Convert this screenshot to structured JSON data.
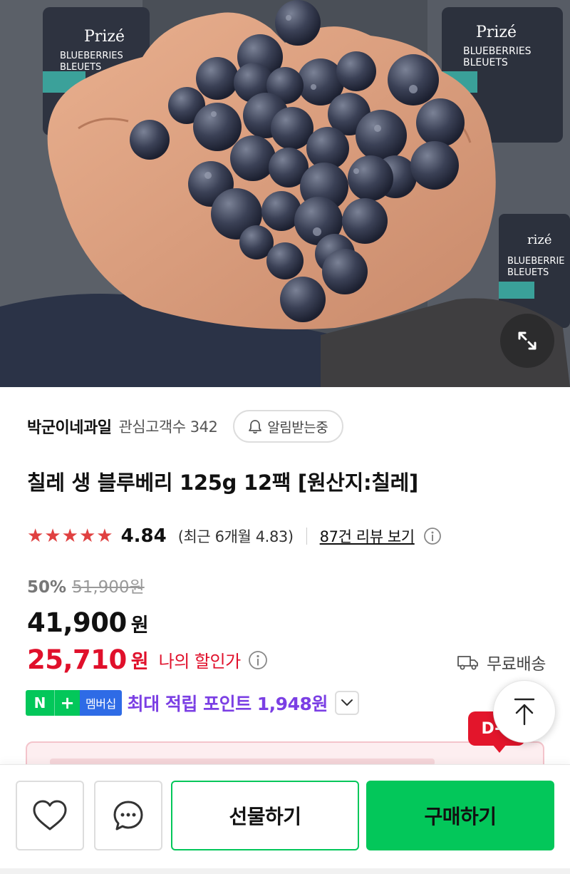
{
  "product_image": {
    "alt": "blueberries-in-hands",
    "package_brand": "Prizé",
    "package_label_1": "BLUEBERRIES",
    "package_label_2": "BLEUETS",
    "expand_icon": "expand-icon"
  },
  "store": {
    "name": "박군이네과일",
    "fans_label": "관심고객수 342",
    "alarm_label": "알림받는중",
    "alarm_icon": "bell-icon"
  },
  "product": {
    "title": "칠레 생 블루베리 125g 12팩 [원산지:칠레]"
  },
  "rating": {
    "stars": 5,
    "score": "4.84",
    "recent": "(최근 6개월 4.83)",
    "reviews_link": "87건 리뷰 보기"
  },
  "price": {
    "discount_rate": "50%",
    "original": "51,900원",
    "sale": "41,900",
    "won": "원",
    "my_price": "25,710",
    "my_won": "원",
    "my_label": "나의 할인가",
    "shipping": "무료배송"
  },
  "membership": {
    "n_label": "N",
    "plus_label": "+",
    "member_label": "멤버십",
    "points_text": "최대 적립 포인트 1,948원"
  },
  "badge": {
    "dday": "D-7"
  },
  "bottom_bar": {
    "gift_label": "선물하기",
    "buy_label": "구매하기"
  },
  "colors": {
    "naver_green": "#03c75a",
    "discount_red": "#e0102b",
    "star_red": "#e04141",
    "points_purple": "#7b3fe4",
    "member_blue": "#2e6be6"
  }
}
